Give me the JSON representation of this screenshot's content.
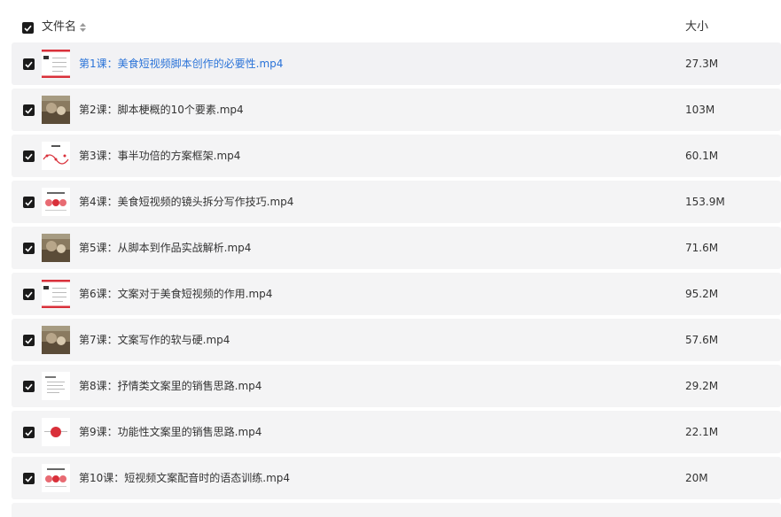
{
  "header": {
    "name_column": "文件名",
    "size_column": "大小"
  },
  "files": [
    {
      "name": "第1课：美食短视频脚本创作的必要性.mp4",
      "size": "27.3M",
      "thumb": "slide-red-header-icon"
    },
    {
      "name": "第2课：脚本梗概的10个要素.mp4",
      "size": "103M",
      "thumb": "video-photo-icon"
    },
    {
      "name": "第3课：事半功倍的方案框架.mp4",
      "size": "60.1M",
      "thumb": "slide-wave-icon"
    },
    {
      "name": "第4课：美食短视频的镜头拆分写作技巧.mp4",
      "size": "153.9M",
      "thumb": "slide-circles-icon"
    },
    {
      "name": "第5课：从脚本到作品实战解析.mp4",
      "size": "71.6M",
      "thumb": "video-photo-icon"
    },
    {
      "name": "第6课：文案对于美食短视频的作用.mp4",
      "size": "95.2M",
      "thumb": "slide-red-header-icon"
    },
    {
      "name": "第7课：文案写作的软与硬.mp4",
      "size": "57.6M",
      "thumb": "video-photo-icon"
    },
    {
      "name": "第8课：抒情类文案里的销售思路.mp4",
      "size": "29.2M",
      "thumb": "slide-text-icon"
    },
    {
      "name": "第9课：功能性文案里的销售思路.mp4",
      "size": "22.1M",
      "thumb": "slide-red-dot-icon"
    },
    {
      "name": "第10课：短视频文案配音时的语态训练.mp4",
      "size": "20M",
      "thumb": "slide-circles-icon"
    }
  ],
  "colors": {
    "link": "#2a73d8",
    "row_bg": "#f4f4f5",
    "checkbox": "#1b1b1b",
    "accent_red": "#d9303a"
  }
}
